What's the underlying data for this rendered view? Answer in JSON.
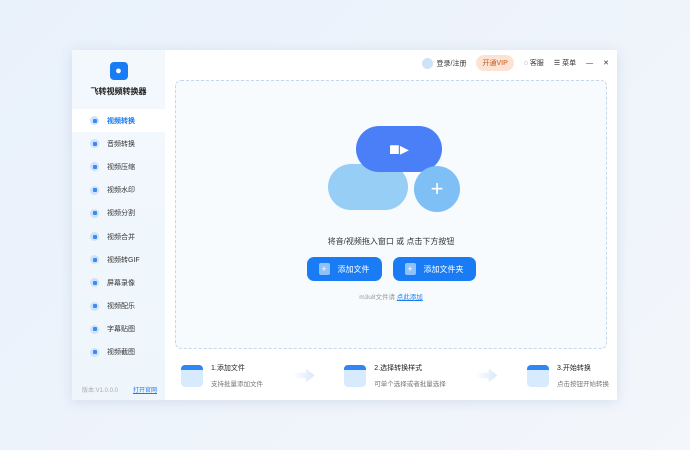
{
  "app": {
    "name": "飞转视频转换器",
    "version": "版本:V1.0.0.0",
    "website": "打开官网"
  },
  "sidebar": {
    "items": [
      {
        "label": "视频转换",
        "active": true
      },
      {
        "label": "音频转换"
      },
      {
        "label": "视频压缩"
      },
      {
        "label": "视频水印"
      },
      {
        "label": "视频分割"
      },
      {
        "label": "视频合并"
      },
      {
        "label": "视频转GIF"
      },
      {
        "label": "屏幕录像"
      },
      {
        "label": "视频配乐"
      },
      {
        "label": "字幕贴图"
      },
      {
        "label": "视频截图"
      }
    ]
  },
  "topbar": {
    "login": "登录/注册",
    "vip": "开通VIP",
    "service": "客服",
    "menu": "菜单",
    "minimize": "—",
    "close": "✕"
  },
  "drop": {
    "hint": "将音/视频拖入窗口  或  点击下方按钮",
    "add_file": "添加文件",
    "add_folder": "添加文件夹",
    "m3u8_text": "m3u8文件请",
    "m3u8_link": "点此添加",
    "plus": "+"
  },
  "steps": [
    {
      "title": "1.添加文件",
      "desc": "支持批量添加文件"
    },
    {
      "title": "2.选择转换样式",
      "desc": "可单个选择或者批量选择"
    },
    {
      "title": "3.开始转换",
      "desc": "点击按钮开始转换"
    }
  ],
  "colors": {
    "accent": "#1a7cf5"
  }
}
